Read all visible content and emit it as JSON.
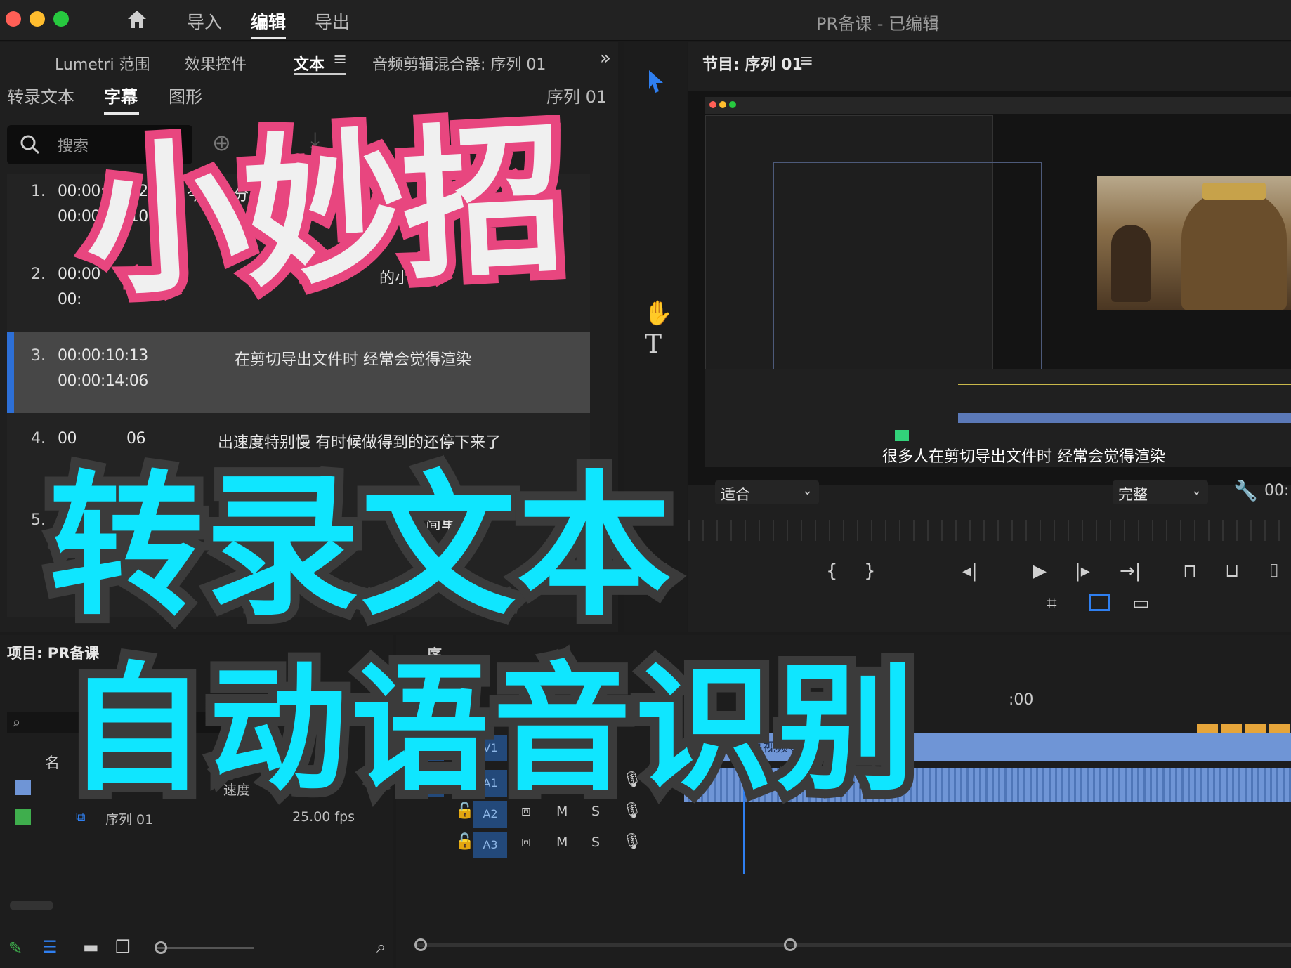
{
  "window": {
    "title": "PR备课 - 已编辑",
    "menu": [
      "导入",
      "编辑",
      "导出"
    ],
    "active_menu": "编辑"
  },
  "left_panel": {
    "tabs": [
      "Lumetri 范围",
      "效果控件",
      "文本",
      "音频剪辑混合器: 序列 01"
    ],
    "subtabs": [
      "转录文本",
      "字幕",
      "图形"
    ],
    "sequence_label": "序列 01",
    "search_placeholder": "搜索",
    "captions": [
      {
        "num": "1.",
        "start": "00:00:05:02",
        "end": "00:00:06:10",
        "text": "今天来分享一"
      },
      {
        "num": "2.",
        "start": "00:00",
        "end": "00:",
        "text": "的小"
      },
      {
        "num": "3.",
        "start": "00:00:10:13",
        "end": "00:00:14:06",
        "text": "在剪切导出文件时 经常会觉得渲染"
      },
      {
        "num": "4.",
        "start": "00",
        "end": "06",
        "text": "出速度特别慢 有时候做得到的还停下来了"
      },
      {
        "num": "5.",
        "start": "",
        "end": "",
        "text": "简单"
      }
    ]
  },
  "program_monitor": {
    "title": "节目: 序列 01",
    "subtitle": "很多人在剪切导出文件时 经常会觉得渲染",
    "fit_label": "适合",
    "quality_label": "完整",
    "timecode": "00:"
  },
  "project_panel": {
    "title": "项目: PR备课",
    "name_col": "名",
    "items": [
      {
        "name": "速度",
        "color": "#6f95d6",
        "fps": ""
      },
      {
        "name": "序列 01",
        "color": "#3fae4d",
        "fps": "25.00 fps"
      }
    ]
  },
  "timeline": {
    "tracks": [
      {
        "label": "V1",
        "target": "V1"
      },
      {
        "label": "A1",
        "target": "A1"
      },
      {
        "label": "",
        "target": "A2"
      },
      {
        "label": "",
        "target": "A3"
      }
    ],
    "clip_name": "如何提高视频导出速度.mp4 [V]",
    "timecode_fragment": ":00",
    "seq_label": "序"
  },
  "overlay": {
    "line1": "小妙招",
    "line2": "转录文本",
    "line3": "自动语音识别"
  },
  "colors": {
    "pink": "#e8467f",
    "cyan": "#0fe6ff",
    "accent_blue": "#2d6fd6"
  }
}
